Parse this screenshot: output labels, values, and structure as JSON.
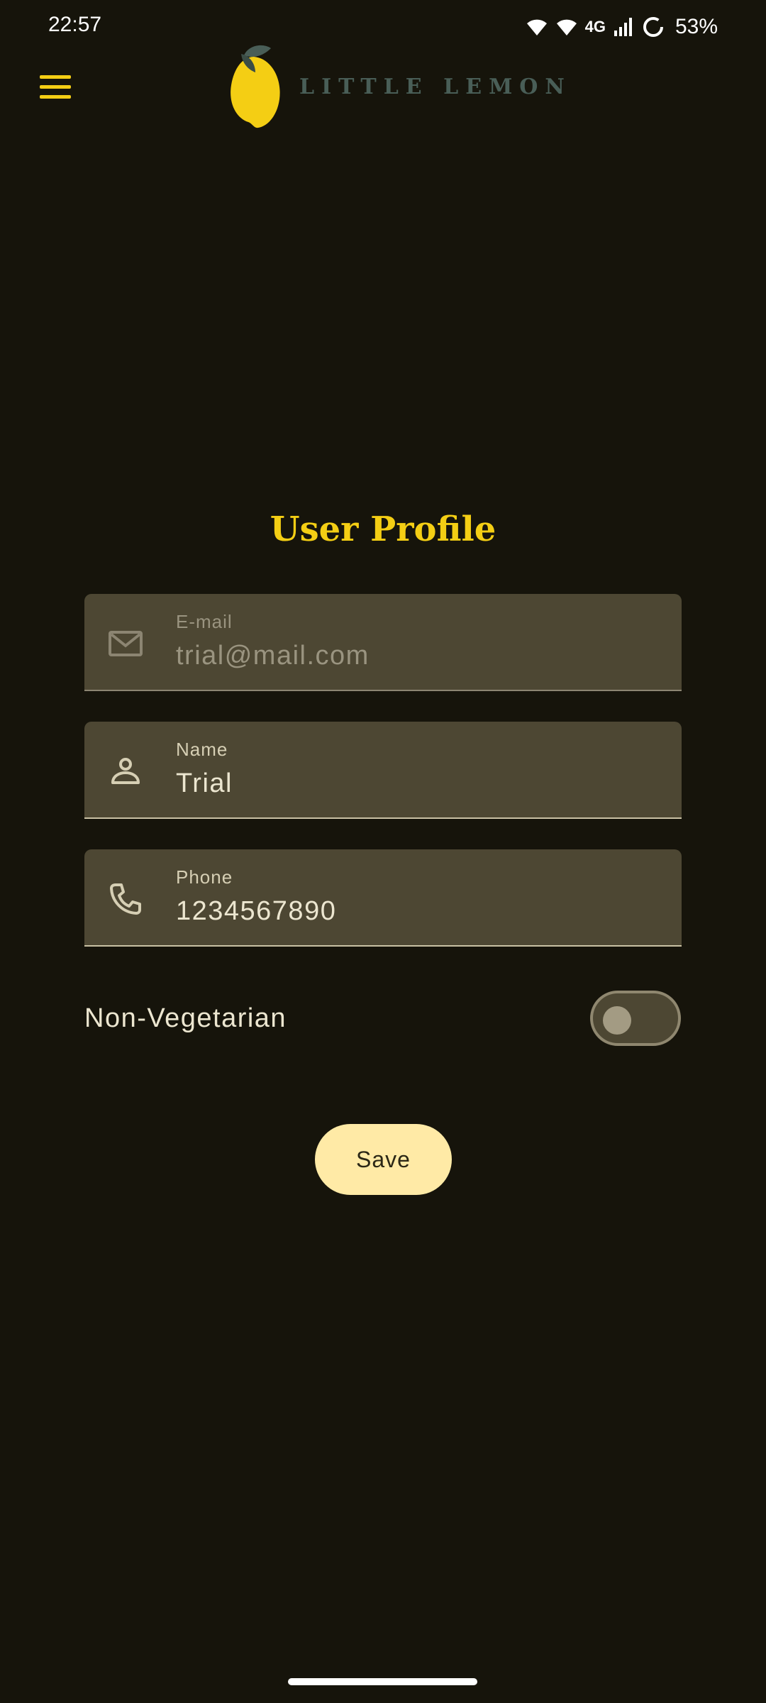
{
  "status_bar": {
    "time": "22:57",
    "network": "4G",
    "battery": "53%"
  },
  "app_bar": {
    "logo_text": "LITTLE LEMON",
    "menu_icon": "hamburger-menu-icon"
  },
  "profile": {
    "title": "User Profile",
    "fields": [
      {
        "label": "E-mail",
        "value": "trial@mail.com",
        "icon": "mail-icon",
        "enabled": false
      },
      {
        "label": "Name",
        "value": "Trial",
        "icon": "person-icon",
        "enabled": true
      },
      {
        "label": "Phone",
        "value": "1234567890",
        "icon": "phone-icon",
        "enabled": true
      }
    ],
    "toggle": {
      "label": "Non-Vegetarian",
      "checked": false
    },
    "save_label": "Save"
  },
  "colors": {
    "background": "#16140b",
    "accent_yellow": "#f4ce14",
    "logo_green": "#495e57",
    "field_bg": "#4d4733",
    "button_bg": "#ffeaa6"
  }
}
